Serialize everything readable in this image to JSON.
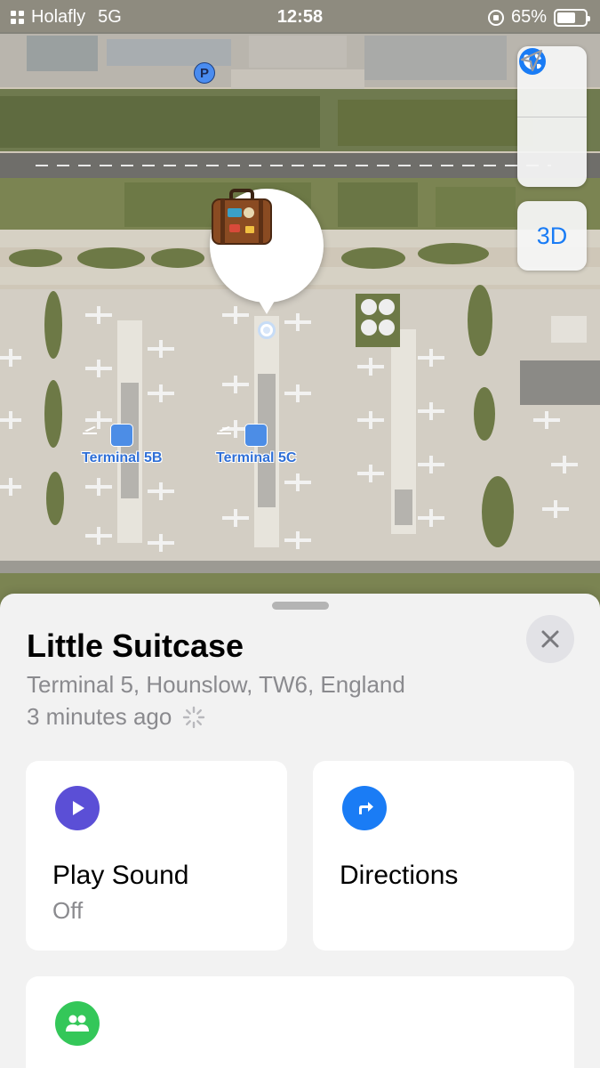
{
  "status_bar": {
    "carrier": "Holafly",
    "network": "5G",
    "time": "12:58",
    "battery": "65%",
    "battery_level": 0.65
  },
  "map": {
    "parking_label": "P",
    "controls": {
      "globe_icon": "globe-icon",
      "location_icon": "location-arrow-icon",
      "view_3d_label": "3D"
    },
    "pin_emoji": "🧳",
    "terminals": [
      {
        "label": "Terminal 5B"
      },
      {
        "label": "Terminal 5C"
      }
    ],
    "accent_color": "#1a7cf5"
  },
  "sheet": {
    "title": "Little Suitcase",
    "address": "Terminal 5, Hounslow, TW6, England",
    "time_ago": "3 minutes ago",
    "close_icon": "close-icon",
    "actions": {
      "play_sound": {
        "label": "Play Sound",
        "sub": "Off",
        "icon": "play-icon",
        "color": "#5b4fd6"
      },
      "directions": {
        "label": "Directions",
        "icon": "directions-arrow-icon",
        "color": "#1a7cf5"
      },
      "share": {
        "icon": "people-icon",
        "color": "#34c759"
      }
    }
  }
}
